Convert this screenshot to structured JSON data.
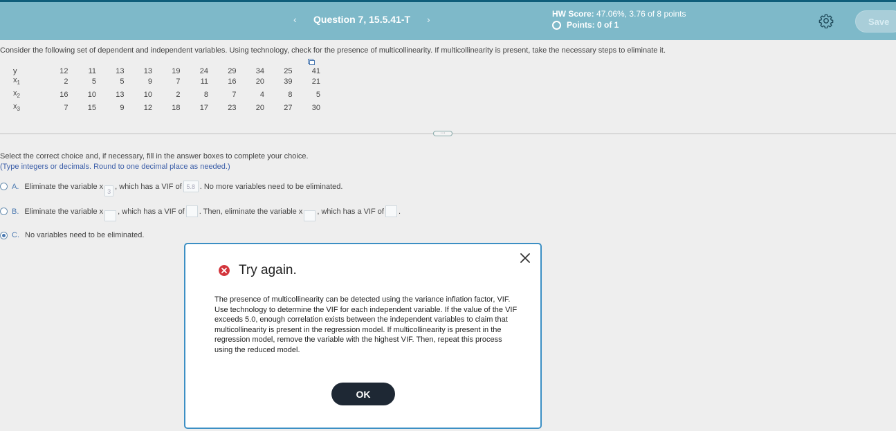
{
  "header": {
    "prev_label": "‹",
    "next_label": "›",
    "question_title": "Question 7, 15.5.41-T",
    "hw_score_label": "HW Score:",
    "hw_score_value": "47.06%, 3.76 of 8 points",
    "points_text": "Points: 0 of 1",
    "save_label": "Save",
    "colors": {
      "header_bg": "#7eb9c9",
      "topline": "#0f5e7a"
    }
  },
  "question": {
    "text": "Consider the following set of dependent and independent variables. Using technology, check for the presence of multicollinearity. If multicollinearity is present, take the necessary steps to eliminate it."
  },
  "table": {
    "rows": [
      {
        "label": "y",
        "sub": "",
        "values": [
          "12",
          "11",
          "13",
          "13",
          "19",
          "24",
          "29",
          "34",
          "25",
          "41"
        ]
      },
      {
        "label": "x",
        "sub": "1",
        "values": [
          "2",
          "5",
          "5",
          "9",
          "7",
          "11",
          "16",
          "20",
          "39",
          "21"
        ]
      },
      {
        "label": "x",
        "sub": "2",
        "values": [
          "16",
          "10",
          "13",
          "10",
          "2",
          "8",
          "7",
          "4",
          "8",
          "5"
        ]
      },
      {
        "label": "x",
        "sub": "3",
        "values": [
          "7",
          "15",
          "9",
          "12",
          "18",
          "17",
          "23",
          "20",
          "27",
          "30"
        ]
      }
    ]
  },
  "answer": {
    "instruction": "Select the correct choice and, if necessary, fill in the answer boxes to complete your choice.",
    "hint": "(Type integers or decimals. Round to one decimal place as needed.)",
    "choiceA": {
      "letter": "A.",
      "part1": "Eliminate the variable x",
      "sub_value": "3",
      "part2": ", which has a VIF of",
      "vif_value": "5.8",
      "part3": ". No more variables need to be eliminated."
    },
    "choiceB": {
      "letter": "B.",
      "part1": "Eliminate the variable x",
      "part2": ", which has a VIF of",
      "part3": ". Then, eliminate the variable x",
      "part4": ", which has a VIF of",
      "part5": "."
    },
    "choiceC": {
      "letter": "C.",
      "text": "No variables need to be eliminated.",
      "selected": true
    }
  },
  "dialog": {
    "title": "Try again.",
    "body": "The presence of multicollinearity can be detected using the variance inflation factor, VIF. Use technology to determine the VIF for each independent variable. If the value of the VIF exceeds 5.0, enough correlation exists between the independent variables to claim that multicollinearity is present in the regression model. If multicollinearity is present in the regression model, remove the variable with the highest VIF. Then, repeat this process using the reduced model.",
    "ok_label": "OK",
    "colors": {
      "error": "#d3353c",
      "border": "#3c8fc4",
      "ok_bg": "#1e2834"
    }
  }
}
